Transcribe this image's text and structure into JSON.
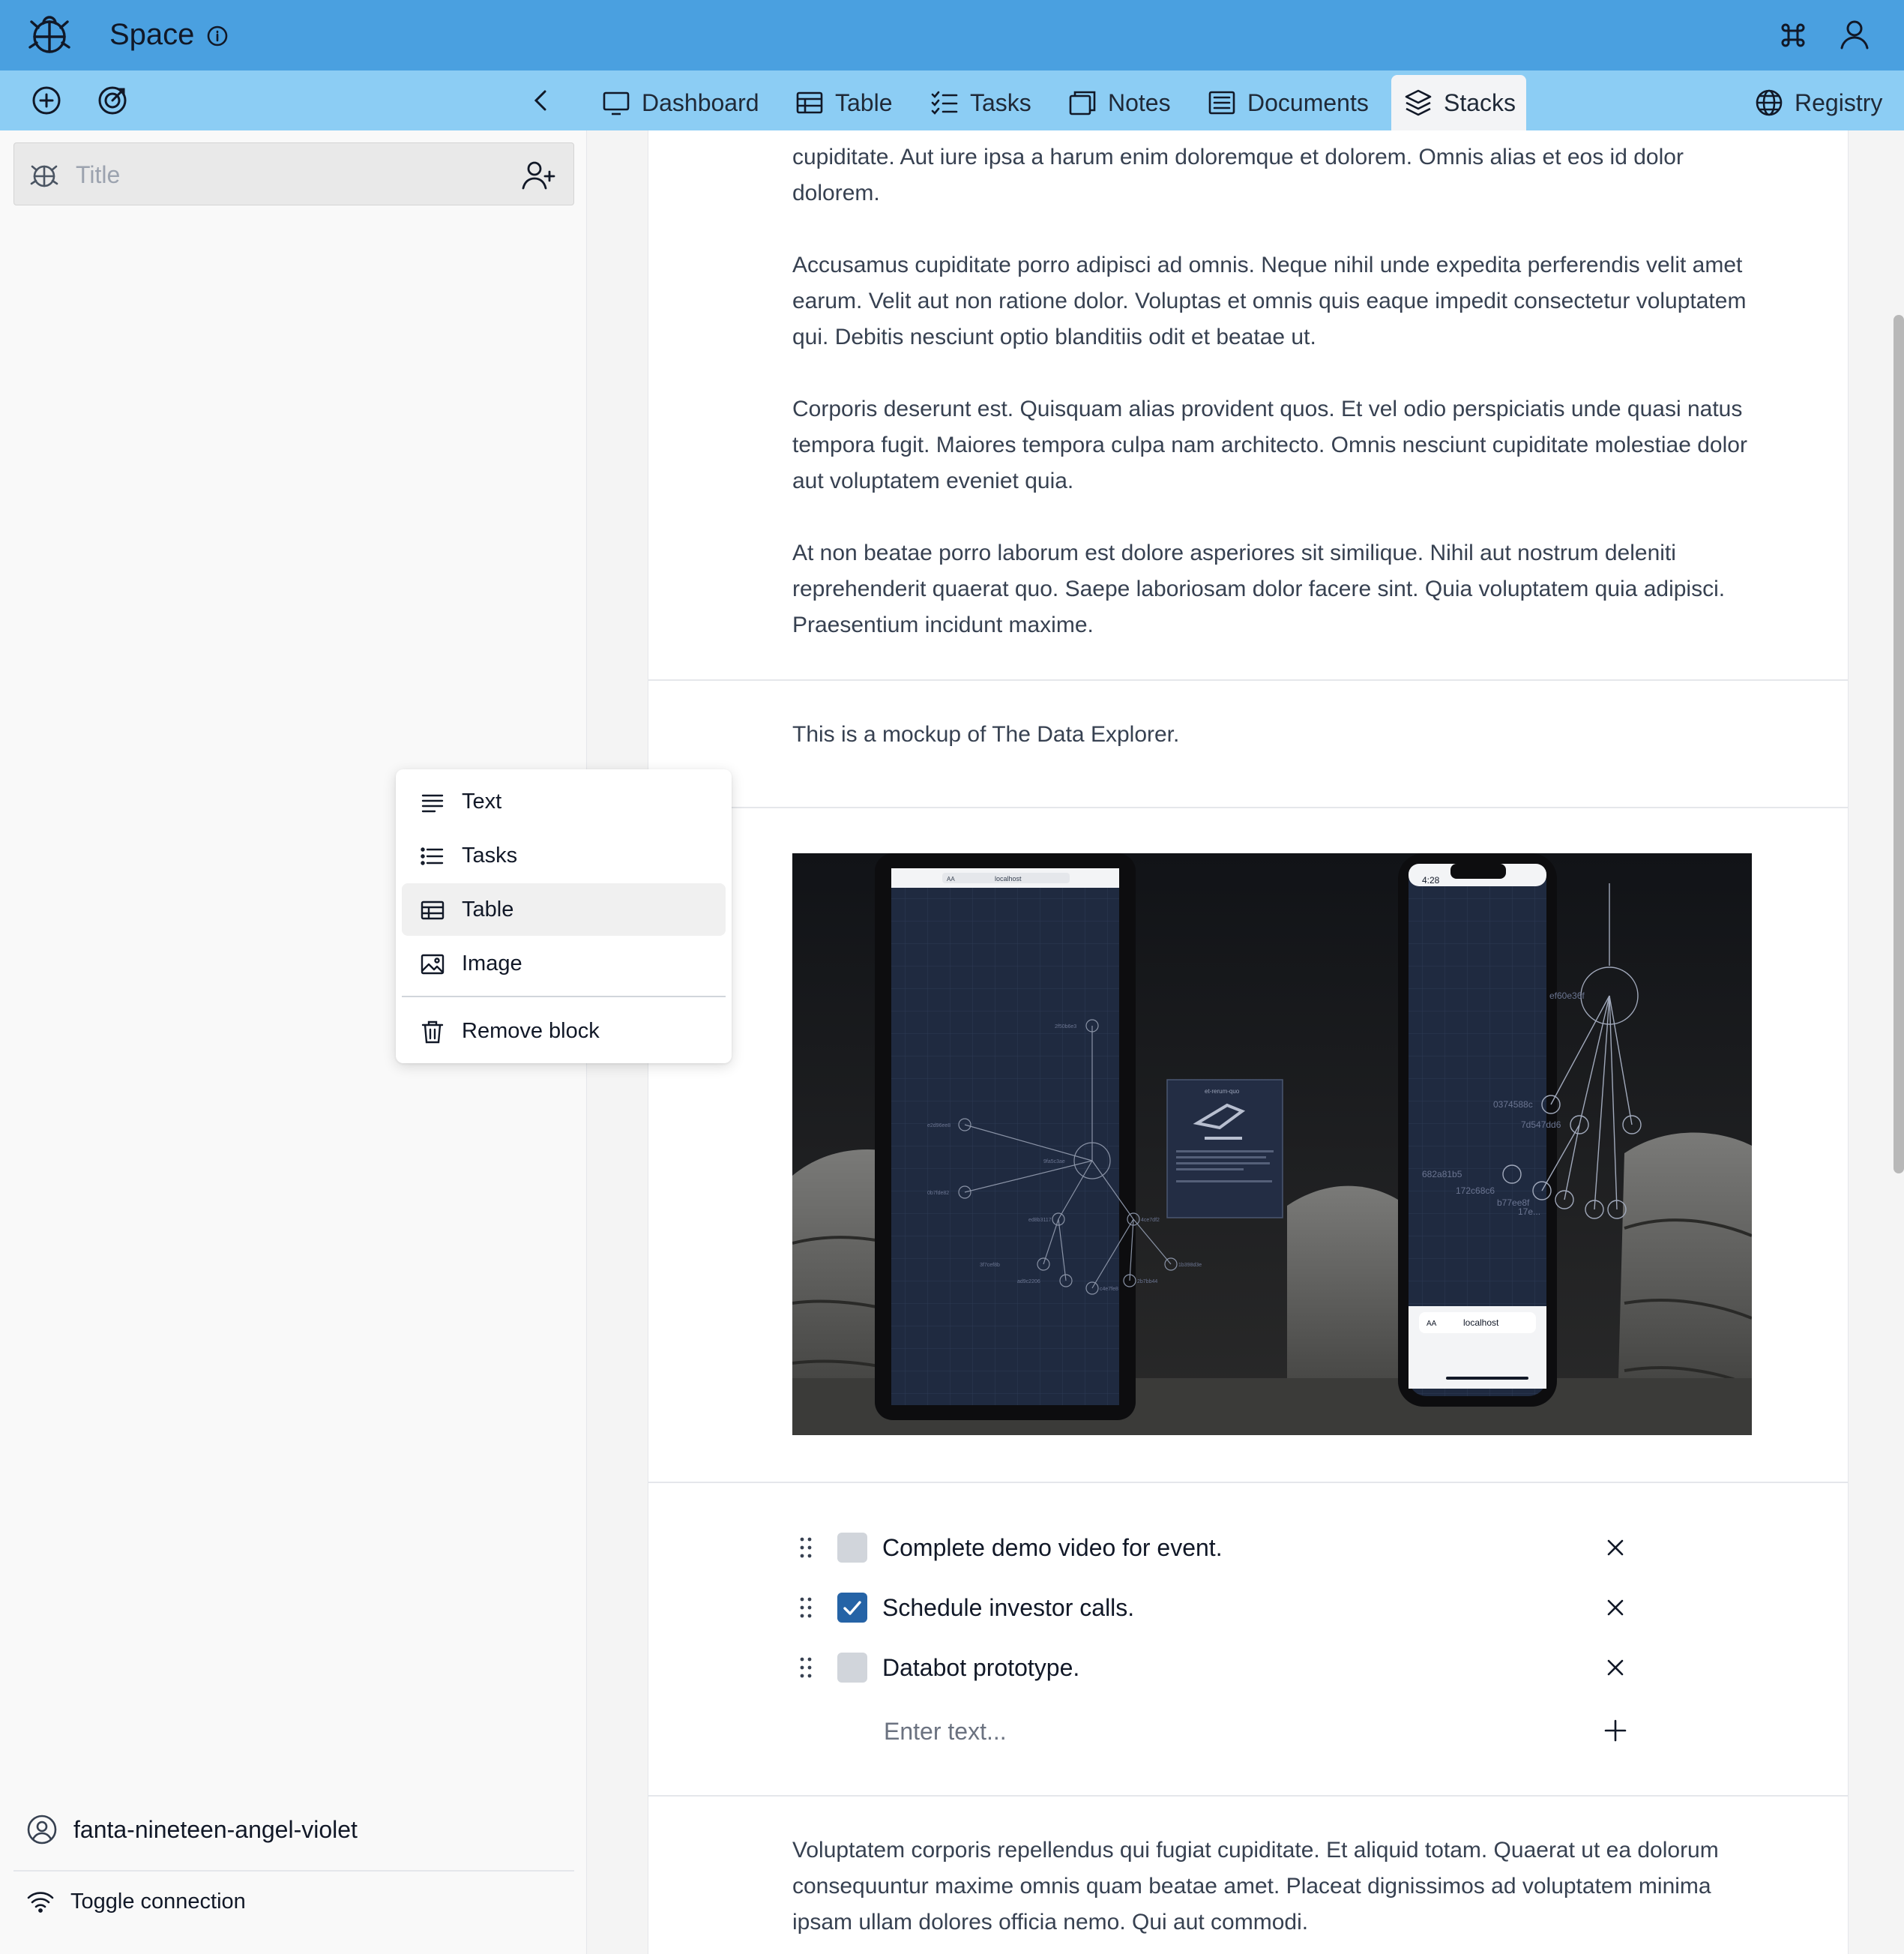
{
  "app": {
    "title": "Space"
  },
  "nav": {
    "tabs": [
      {
        "label": "Dashboard",
        "icon": "monitor-icon"
      },
      {
        "label": "Table",
        "icon": "table-icon"
      },
      {
        "label": "Tasks",
        "icon": "tasks-icon"
      },
      {
        "label": "Notes",
        "icon": "notes-icon"
      },
      {
        "label": "Documents",
        "icon": "document-icon"
      },
      {
        "label": "Stacks",
        "icon": "layers-icon",
        "active": true
      }
    ],
    "registry_label": "Registry"
  },
  "sidebar": {
    "title_placeholder": "Title",
    "identity": "fanta-nineteen-angel-violet",
    "toggle_connection": "Toggle connection"
  },
  "document": {
    "paragraphs_top": [
      "cupiditate. Aut iure ipsa a harum enim doloremque et dolorem. Omnis alias et eos id dolor dolorem.",
      "Accusamus cupiditate porro adipisci ad omnis. Neque nihil unde expedita perferendis velit amet earum. Velit aut non ratione dolor. Voluptas et omnis quis eaque impedit consectetur voluptatem qui. Debitis nesciunt optio blanditiis odit et beatae ut.",
      "Corporis deserunt est. Quisquam alias provident quos. Et vel odio perspiciatis unde quasi natus tempora fugit. Maiores tempora culpa nam architecto. Omnis nesciunt cupiditate molestiae dolor aut voluptatem eveniet quia.",
      "At non beatae porro laborum est dolore asperiores sit similique. Nihil aut nostrum deleniti reprehenderit quaerat quo. Saepe laboriosam dolor facere sint. Quia voluptatem quia adipisci. Praesentium incidunt maxime."
    ],
    "mockup_caption": "This is a mockup of The Data Explorer.",
    "image": {
      "ipad_url": "localhost",
      "phone_url": "localhost",
      "phone_time": "4:28",
      "phone_url_prefix": "AA",
      "ipad_url_prefix": "AA",
      "ipad_card_title": "et-rerum-quo",
      "ipad_nodes": [
        "2f50b6e3",
        "e2d96ee8",
        "9fa5c3ae",
        "0b7fde82",
        "ed8b3117",
        "4ce7df2",
        "3f7cef8b",
        "ad9c2206",
        "c4e7fe8",
        "2b7bb44",
        "1b398d3e"
      ],
      "phone_nodes": [
        "ef60e36f",
        "0374588c",
        "7d547dd6",
        "682a81b5",
        "172c68c6",
        "b77ee8f",
        "17e..."
      ]
    },
    "tasks": [
      {
        "text": "Complete demo video for event.",
        "done": false
      },
      {
        "text": "Schedule investor calls.",
        "done": true
      },
      {
        "text": "Databot prototype.",
        "done": false
      }
    ],
    "new_task_placeholder": "Enter text...",
    "paragraph_bottom": "Voluptatem corporis repellendus qui fugiat cupiditate. Et aliquid totam. Quaerat ut ea dolorum consequuntur maxime omnis quam beatae amet. Placeat dignissimos ad voluptatem minima ipsam ullam dolores officia nemo. Qui aut commodi."
  },
  "context_menu": {
    "items": [
      {
        "label": "Text",
        "icon": "text-lines-icon"
      },
      {
        "label": "Tasks",
        "icon": "list-icon"
      },
      {
        "label": "Table",
        "icon": "table-icon",
        "highlighted": true
      },
      {
        "label": "Image",
        "icon": "image-icon"
      }
    ],
    "remove_label": "Remove block"
  },
  "colors": {
    "topbar": "#4aa0e0",
    "tabbar": "#8ccdf4",
    "checkbox_checked": "#2563a6"
  }
}
